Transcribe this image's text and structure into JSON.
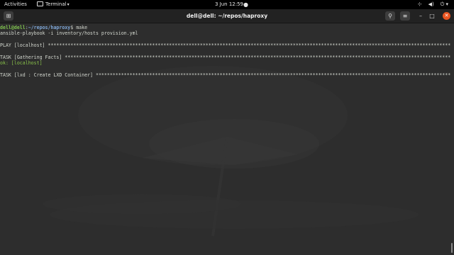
{
  "topbar": {
    "activities": "Activities",
    "app_name": "Terminal",
    "clock": "3 Jun  12:59",
    "tray_icons": [
      "network-icon",
      "volume-icon",
      "power-icon"
    ]
  },
  "window": {
    "title": "dell@dell: ~/repos/haproxy",
    "buttons": [
      "new-tab-icon",
      "search-icon",
      "hamburger-menu-icon",
      "minimize-icon",
      "maximize-icon",
      "close-icon"
    ]
  },
  "terminal": {
    "prompt_user": "dell@dell",
    "prompt_sep": ":",
    "prompt_path": "~/repos/haproxy",
    "prompt_end": "$ make",
    "command_line": "ansible-playbook -i inventory/hosts provision.yml",
    "play_line": "PLAY [localhost] ***********************************************************************************************************************************************",
    "task1_line": "TASK [Gathering Facts] *****************************************************************************************************************************************",
    "ok_line": "ok: [localhost]",
    "task2_line": "TASK [lxd : Create LXD Container] ******************************************************************************************************************************"
  },
  "colors": {
    "prompt_user": "#7fc24e",
    "prompt_path": "#7ea7d8",
    "ok": "#8ac34a",
    "close_button": "#e95420"
  }
}
